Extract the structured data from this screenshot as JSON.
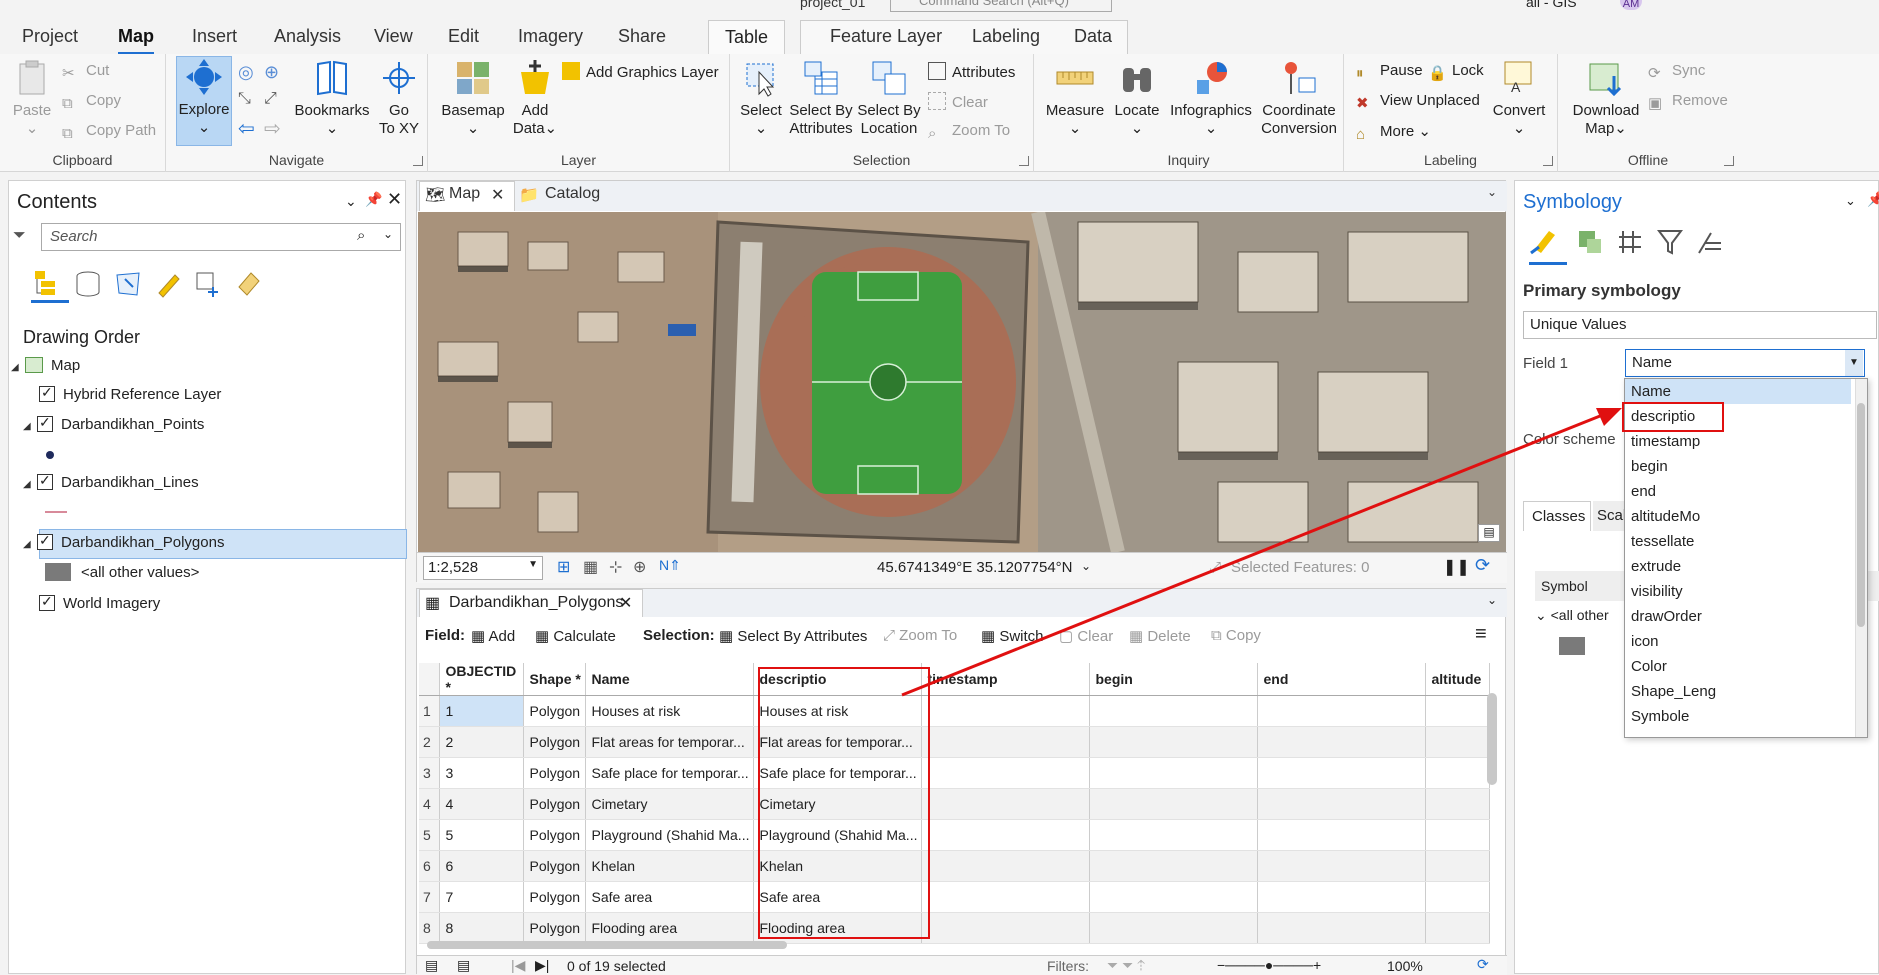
{
  "titlebar": {
    "project": "project_01",
    "command_search": "Command Search (Alt+Q)",
    "user": "all - GIS",
    "initials": "AM"
  },
  "menu_tabs": [
    "Project",
    "Map",
    "Insert",
    "Analysis",
    "View",
    "Edit",
    "Imagery",
    "Share"
  ],
  "context_tabs": {
    "table": "Table",
    "feature_layer": "Feature Layer",
    "labeling": "Labeling",
    "data": "Data"
  },
  "ribbon": {
    "clipboard": {
      "paste": "Paste",
      "cut": "Cut",
      "copy": "Copy",
      "copy_path": "Copy Path",
      "label": "Clipboard"
    },
    "navigate": {
      "explore": "Explore",
      "bookmarks": "Bookmarks",
      "goto_1": "Go",
      "goto_2": "To XY",
      "label": "Navigate"
    },
    "layer": {
      "basemap": "Basemap",
      "add_data_1": "Add",
      "add_data_2": "Data",
      "add_graphics": "Add Graphics Layer",
      "label": "Layer"
    },
    "selection": {
      "select": "Select",
      "sel_attr_1": "Select By",
      "sel_attr_2": "Attributes",
      "sel_loc_1": "Select By",
      "sel_loc_2": "Location",
      "attributes": "Attributes",
      "clear": "Clear",
      "zoom_to": "Zoom To",
      "label": "Selection"
    },
    "inquiry": {
      "measure": "Measure",
      "locate": "Locate",
      "infographics": "Infographics",
      "coord_1": "Coordinate",
      "coord_2": "Conversion",
      "label": "Inquiry"
    },
    "labeling": {
      "pause": "Pause",
      "lock": "Lock",
      "view_unplaced": "View Unplaced",
      "more": "More",
      "convert": "Convert",
      "label": "Labeling"
    },
    "offline": {
      "download_1": "Download",
      "download_2": "Map",
      "sync": "Sync",
      "remove": "Remove",
      "label": "Offline"
    }
  },
  "contents": {
    "title": "Contents",
    "search_placeholder": "Search",
    "drawing_order": "Drawing Order",
    "map": "Map",
    "layers": {
      "hybrid": "Hybrid Reference Layer",
      "points": "Darbandikhan_Points",
      "lines": "Darbandikhan_Lines",
      "polygons": "Darbandikhan_Polygons",
      "all_other": "<all other values>",
      "world": "World Imagery"
    }
  },
  "map_view": {
    "tabs": {
      "map": "Map",
      "catalog": "Catalog"
    },
    "scale": "1:2,528",
    "coordinates": "45.6741349°E 35.1207754°N",
    "selected_features": "Selected Features: 0"
  },
  "table_view": {
    "tab": "Darbandikhan_Polygons",
    "toolbar": {
      "field": "Field:",
      "add": "Add",
      "calculate": "Calculate",
      "selection": "Selection:",
      "select_by_attributes": "Select By Attributes",
      "zoom_to": "Zoom To",
      "switch": "Switch",
      "clear": "Clear",
      "delete": "Delete",
      "copy": "Copy"
    },
    "columns": [
      "OBJECTID *",
      "Shape *",
      "Name",
      "descriptio",
      "timestamp",
      "begin",
      "end",
      "altitude"
    ],
    "rows": [
      [
        "1",
        "1",
        "Polygon",
        "Houses at risk",
        "Houses at risk"
      ],
      [
        "2",
        "2",
        "Polygon",
        "Flat areas for temporar...",
        "Flat areas for temporar..."
      ],
      [
        "3",
        "3",
        "Polygon",
        "Safe place for temporar...",
        "Safe place for temporar..."
      ],
      [
        "4",
        "4",
        "Polygon",
        "Cimetary",
        "Cimetary"
      ],
      [
        "5",
        "5",
        "Polygon",
        "Playground (Shahid Ma...",
        "Playground (Shahid Ma..."
      ],
      [
        "6",
        "6",
        "Polygon",
        "Khelan",
        "Khelan"
      ],
      [
        "7",
        "7",
        "Polygon",
        "Safe area",
        "Safe area"
      ],
      [
        "8",
        "8",
        "Polygon",
        "Flooding area",
        "Flooding area"
      ]
    ],
    "status": {
      "selected": "0 of 19 selected",
      "filters": "Filters:",
      "zoom": "100%"
    }
  },
  "symbology": {
    "title": "Symbology",
    "primary": "Primary symbology",
    "method": "Unique Values",
    "field1_label": "Field 1",
    "field1_value": "Name",
    "color_scheme": "Color scheme",
    "classes_tab": "Classes",
    "scale_tab": "Scal",
    "symbol_header": "Symbol",
    "all_other": "<all other",
    "dropdown_options": [
      "Name",
      "descriptio",
      "timestamp",
      "begin",
      "end",
      "altitudeMo",
      "tessellate",
      "extrude",
      "visibility",
      "drawOrder",
      "icon",
      "Color",
      "Shape_Leng",
      "Symbole"
    ]
  },
  "colors": {
    "accent": "#1e6fd1",
    "annotation_red": "#e01010",
    "selection_blue": "#cfe3f7"
  }
}
